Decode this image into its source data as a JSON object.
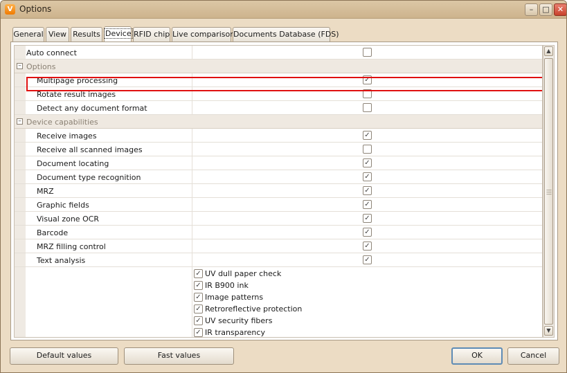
{
  "window": {
    "title": "Options",
    "icon": "app-v-icon"
  },
  "titlebar_buttons": {
    "minimize": "minimize-icon",
    "maximize": "maximize-icon",
    "close": "close-icon"
  },
  "tabs": [
    {
      "label": "General"
    },
    {
      "label": "View"
    },
    {
      "label": "Results"
    },
    {
      "label": "Device",
      "selected": true
    },
    {
      "label": "RFID chip"
    },
    {
      "label": "Live comparison"
    },
    {
      "label": "Documents Database (FDS)"
    }
  ],
  "properties": {
    "auto_connect": {
      "label": "Auto connect",
      "checked": false
    },
    "options_category": {
      "label": "Options"
    },
    "options": [
      {
        "label": "Multipage processing",
        "checked": true
      },
      {
        "label": "Rotate result images",
        "checked": false
      },
      {
        "label": "Detect any document format",
        "checked": false
      }
    ],
    "capabilities_category": {
      "label": "Device capabilities"
    },
    "capabilities": [
      {
        "label": "Receive images",
        "checked": true
      },
      {
        "label": "Receive all scanned images",
        "checked": false
      },
      {
        "label": "Document locating",
        "checked": true
      },
      {
        "label": "Document type recognition",
        "checked": true
      },
      {
        "label": "MRZ",
        "checked": true
      },
      {
        "label": "Graphic fields",
        "checked": true
      },
      {
        "label": "Visual zone OCR",
        "checked": true
      },
      {
        "label": "Barcode",
        "checked": true
      },
      {
        "label": "MRZ filling control",
        "checked": true
      },
      {
        "label": "Text analysis",
        "checked": true
      }
    ],
    "authenticity_checks": [
      {
        "label": "UV dull paper check",
        "checked": true
      },
      {
        "label": "IR B900 ink",
        "checked": true
      },
      {
        "label": "Image patterns",
        "checked": true
      },
      {
        "label": "Retroreflective protection",
        "checked": true
      },
      {
        "label": "UV security fibers",
        "checked": true
      },
      {
        "label": "IR transparency",
        "checked": true
      }
    ]
  },
  "footer": {
    "default_values": "Default values",
    "fast_values": "Fast values",
    "ok": "OK",
    "cancel": "Cancel"
  },
  "colors": {
    "highlight": "#e01010",
    "accent": "#f07a00"
  }
}
